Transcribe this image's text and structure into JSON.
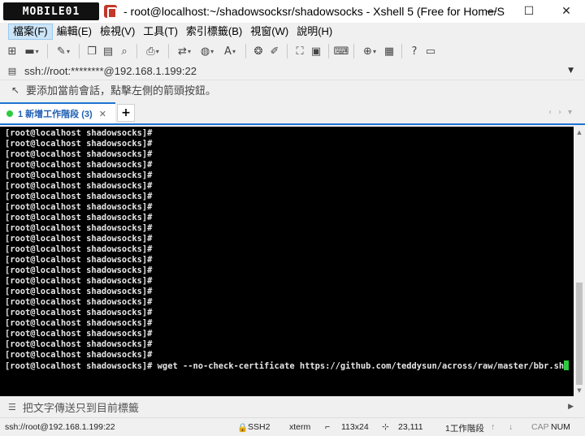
{
  "window": {
    "logo_text": "MOBILE01",
    "title": "- root@localhost:~/shadowsocksr/shadowsocks - Xshell 5 (Free for Home/S...",
    "minimize": "—",
    "maximize": "☐",
    "close": "✕"
  },
  "menu": {
    "items": [
      "檔案(F)",
      "編輯(E)",
      "檢視(V)",
      "工具(T)",
      "索引標籤(B)",
      "視窗(W)",
      "說明(H)"
    ]
  },
  "toolbar": {
    "icons": [
      "new-session-icon",
      "open-folder-icon",
      "disconnect-icon",
      "copy-icon",
      "paste-icon",
      "find-icon",
      "print-icon",
      "transfer-icon",
      "globe-icon",
      "font-icon",
      "xftp-icon",
      "script-icon",
      "fullscreen-icon",
      "lock-icon",
      "keyboard-icon",
      "add-icon",
      "help-icon",
      "chat-icon"
    ]
  },
  "address": {
    "value": "ssh://root:********@192.168.1.199:22"
  },
  "hint": {
    "text": "要添加當前會話，點擊左側的箭頭按鈕。"
  },
  "tabs": [
    {
      "label": "1 新增工作階段 (3)",
      "active": true
    }
  ],
  "terminal": {
    "prompt": "[root@localhost shadowsocks]#",
    "empty_prompt_count": 22,
    "last_command": " wget --no-check-certificate https://github.com/teddysun/across/raw/master/bbr.sh",
    "text_color": "#e6e6e6",
    "cursor_color": "#2ecc40"
  },
  "compose": {
    "placeholder": "把文字傳送只到目前標籤"
  },
  "status": {
    "connection": "ssh://root@192.168.1.199:22",
    "protocol": "SSH2",
    "terminal_type": "xterm",
    "size": "113x24",
    "cursor_pos": "23,111",
    "sessions": "1工作階段",
    "cap": "CAP",
    "num": "NUM"
  },
  "colors": {
    "accent": "#1e73d2",
    "terminal_bg": "#000000",
    "session_dot": "#2ecc40"
  }
}
